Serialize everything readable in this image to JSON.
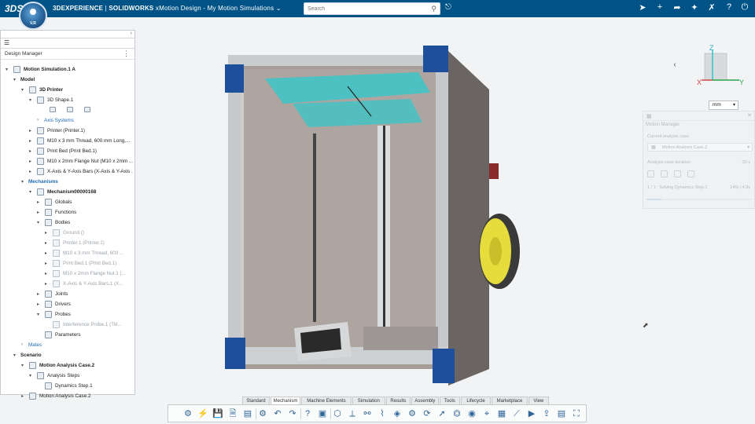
{
  "header": {
    "ds_mark": "3DS",
    "compass_version": "V.R",
    "brand": "3DEXPERIENCE",
    "product": "SOLIDWORKS",
    "app": "xMotion Design",
    "workspace": "My Motion Simulations",
    "search_placeholder": "Search"
  },
  "top_icons": [
    "tag-icon",
    "share-icon",
    "add-icon",
    "forward-icon",
    "network-icon",
    "tools-icon",
    "help-icon",
    "power-icon"
  ],
  "design_manager": {
    "title": "Design Manager",
    "tree": [
      {
        "label": "Motion Simulation.1 A",
        "level": 0,
        "bold": true,
        "twist": "▾",
        "icon": "simulation-icon"
      },
      {
        "label": "Model",
        "level": 1,
        "bold": true,
        "twist": "▾",
        "icon": ""
      },
      {
        "label": "3D Printer",
        "level": 2,
        "bold": true,
        "twist": "▾",
        "icon": "product-icon"
      },
      {
        "label": "3D Shape.1",
        "level": 3,
        "twist": "▾",
        "icon": "shape-icon"
      },
      {
        "label": "",
        "level": 4,
        "twist": "",
        "icon": "",
        "mini": true
      },
      {
        "label": "Axis Systems",
        "level": 4,
        "twist": "›",
        "icon": "",
        "blue": true
      },
      {
        "label": "Printer (Printer.1)",
        "level": 3,
        "twist": "▸",
        "icon": "part-icon"
      },
      {
        "label": "M10 x 3 mm Thread, 600 mm Long,...",
        "level": 3,
        "twist": "▸",
        "icon": "part-icon"
      },
      {
        "label": "Print Bed (Print Bed.1)",
        "level": 3,
        "twist": "▸",
        "icon": "part-icon"
      },
      {
        "label": "M10 x 2mm Flange Nut (M10 x 2mm ...",
        "level": 3,
        "twist": "▸",
        "icon": "part-icon"
      },
      {
        "label": "X-Axis & Y-Axis Bars (X-Axis & Y-Axis ...",
        "level": 3,
        "twist": "▸",
        "icon": "part-icon"
      },
      {
        "label": "Mechanisms",
        "level": 2,
        "twist": "▾",
        "icon": "",
        "blue": true,
        "bold": true
      },
      {
        "label": "Mechanism00000168",
        "level": 3,
        "bold": true,
        "twist": "▾",
        "icon": "mechanism-icon"
      },
      {
        "label": "Globals",
        "level": 4,
        "twist": "▸",
        "icon": "globe-icon"
      },
      {
        "label": "Functions",
        "level": 4,
        "twist": "▸",
        "icon": "function-icon"
      },
      {
        "label": "Bodies",
        "level": 4,
        "twist": "▾",
        "icon": "body-icon"
      },
      {
        "label": "Ground ()",
        "level": 5,
        "twist": "▸",
        "icon": "ground-icon",
        "dim": true
      },
      {
        "label": "Printer.1 (Printer.1)",
        "level": 5,
        "twist": "▸",
        "icon": "body-icon",
        "dim": true
      },
      {
        "label": "M10 x 3 mm Thread, 600 ...",
        "level": 5,
        "twist": "▸",
        "icon": "body-icon",
        "dim": true
      },
      {
        "label": "Print Bed.1 (Print Bed.1)",
        "level": 5,
        "twist": "▸",
        "icon": "body-icon",
        "dim": true
      },
      {
        "label": "M10 x 2mm Flange Nut.1 (...",
        "level": 5,
        "twist": "▸",
        "icon": "body-icon",
        "dim": true
      },
      {
        "label": "X-Axis & Y-Axis Bars.1 (X...",
        "level": 5,
        "twist": "▸",
        "icon": "body-icon",
        "dim": true
      },
      {
        "label": "Joints",
        "level": 4,
        "twist": "▸",
        "icon": "joint-icon"
      },
      {
        "label": "Drivers",
        "level": 4,
        "twist": "▸",
        "icon": "driver-icon"
      },
      {
        "label": "Probes",
        "level": 4,
        "twist": "▾",
        "icon": "probe-icon"
      },
      {
        "label": "Interference Probe.1 (Tilt...",
        "level": 5,
        "twist": "",
        "icon": "probe-icon",
        "dim": true
      },
      {
        "label": "Parameters",
        "level": 4,
        "twist": "",
        "icon": "parameter-icon"
      },
      {
        "label": "Mates",
        "level": 2,
        "twist": "›",
        "icon": "",
        "blue": true
      },
      {
        "label": "Scenario",
        "level": 1,
        "bold": true,
        "twist": "▾",
        "icon": ""
      },
      {
        "label": "Motion Analysis Case.2",
        "level": 2,
        "bold": true,
        "twist": "▾",
        "icon": "analysis-icon"
      },
      {
        "label": "Analysis Steps",
        "level": 3,
        "twist": "▾",
        "icon": "steps-icon"
      },
      {
        "label": "Dynamics Step.1",
        "level": 4,
        "twist": "",
        "icon": "step-icon"
      },
      {
        "label": "Motion Analysis Case.2",
        "level": 2,
        "twist": "▸",
        "icon": "analysis-icon"
      }
    ]
  },
  "compass_axes": {
    "z": "Z",
    "x": "X",
    "y": "Y"
  },
  "units": {
    "selected": "mm"
  },
  "motion_manager": {
    "title": "Motion Manager",
    "current_case_label": "Current analysis case",
    "current_case_value": "Motion Analysis Case.2",
    "duration_label": "Analysis case duration",
    "duration_value": "30 s",
    "progress_text": "1 / 1 : Solving Dynamics Step.1",
    "progress_pct": "14% | 4.9s",
    "progress_fraction": 0.14
  },
  "action_bar": {
    "tabs": [
      "Standard",
      "Mechanism",
      "Machine Elements",
      "Simulation",
      "Results",
      "Assembly",
      "Tools",
      "Lifecycle",
      "Marketplace",
      "View"
    ],
    "active_tab": "Mechanism",
    "icons": [
      "run-simulation-icon",
      "fast-run-icon",
      "save-icon",
      "save-as-icon",
      "properties-icon",
      "settings-icon",
      "undo-icon",
      "redo-icon",
      "help-icon",
      "view-icon",
      "body-icon",
      "axis-icon",
      "joint-icon",
      "spring-icon",
      "contact-icon",
      "gear-icon",
      "driver-icon",
      "force-icon",
      "motor-icon",
      "sensor-icon",
      "probe-icon",
      "result-icon",
      "plot-icon",
      "animate-icon",
      "export-icon",
      "report-icon",
      "capture-icon"
    ]
  },
  "colors": {
    "header": "#005386",
    "accent_cyan": "#29c6c8",
    "frame_blue": "#1d4f9c",
    "filament_yellow": "#e6dd3c"
  }
}
